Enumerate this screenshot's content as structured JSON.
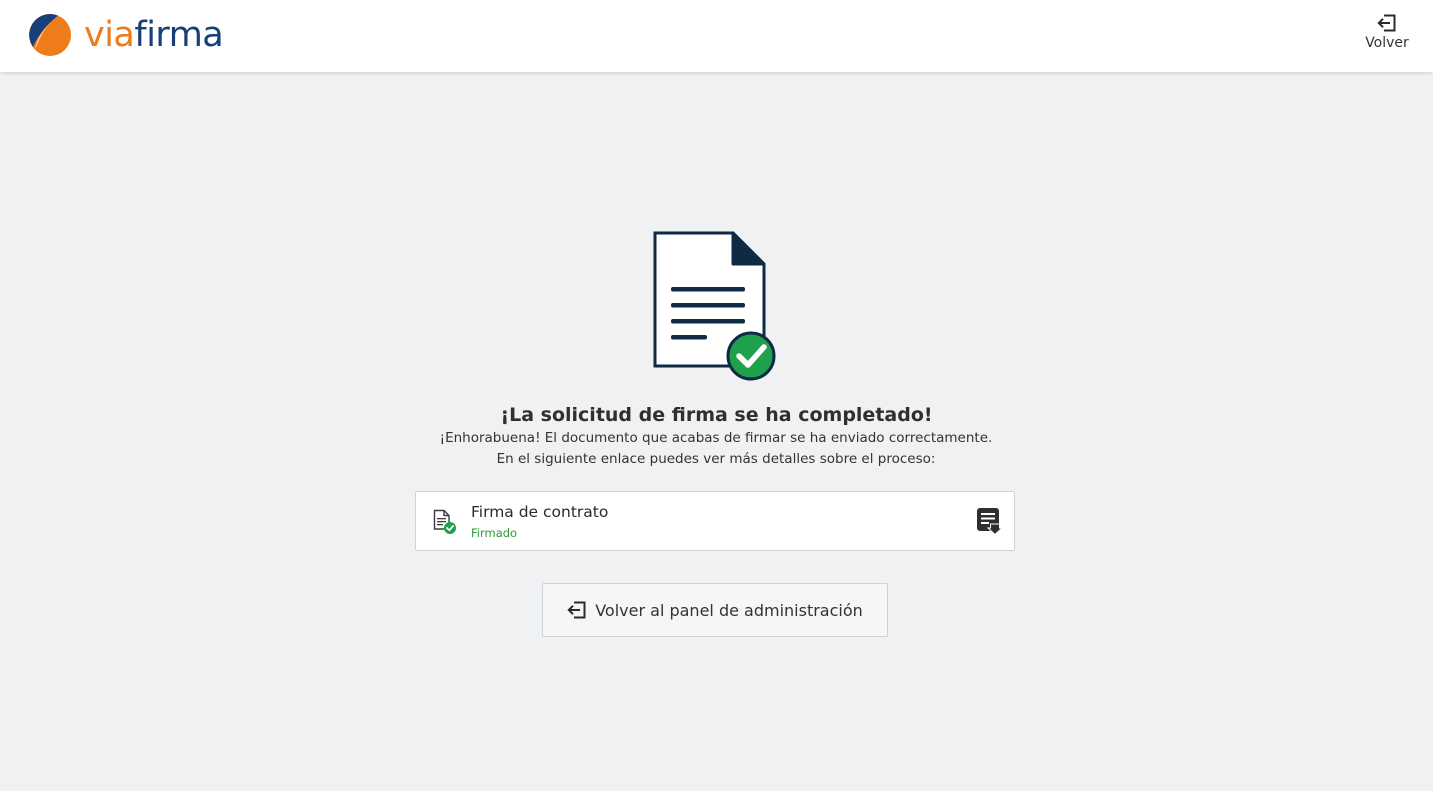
{
  "header": {
    "logo": {
      "part_via": "via",
      "part_firma": "firma",
      "colors": {
        "orange": "#ef7c1a",
        "navy": "#173f7a"
      }
    },
    "back_button": {
      "icon": "sign-out-icon",
      "label": "Volver"
    }
  },
  "main": {
    "hero_icon": "document-signed-icon",
    "title": "¡La solicitud de firma se ha completado!",
    "message": "¡Enhorabuena! El documento que acabas de firmar se ha enviado correctamente. En el siguiente enlace puedes ver más detalles sobre el proceso:",
    "document": {
      "icon": "file-signed-icon",
      "name": "Firma de contrato",
      "status": "Firmado",
      "status_color": "#2e9b3a",
      "action_icon": "download-list-icon"
    },
    "panel_button": {
      "icon": "sign-out-icon",
      "label": "Volver al panel de administración"
    }
  },
  "colors": {
    "background": "#f0f1f3",
    "icon_navy": "#0f2a44",
    "success_green": "#1fa04a"
  }
}
